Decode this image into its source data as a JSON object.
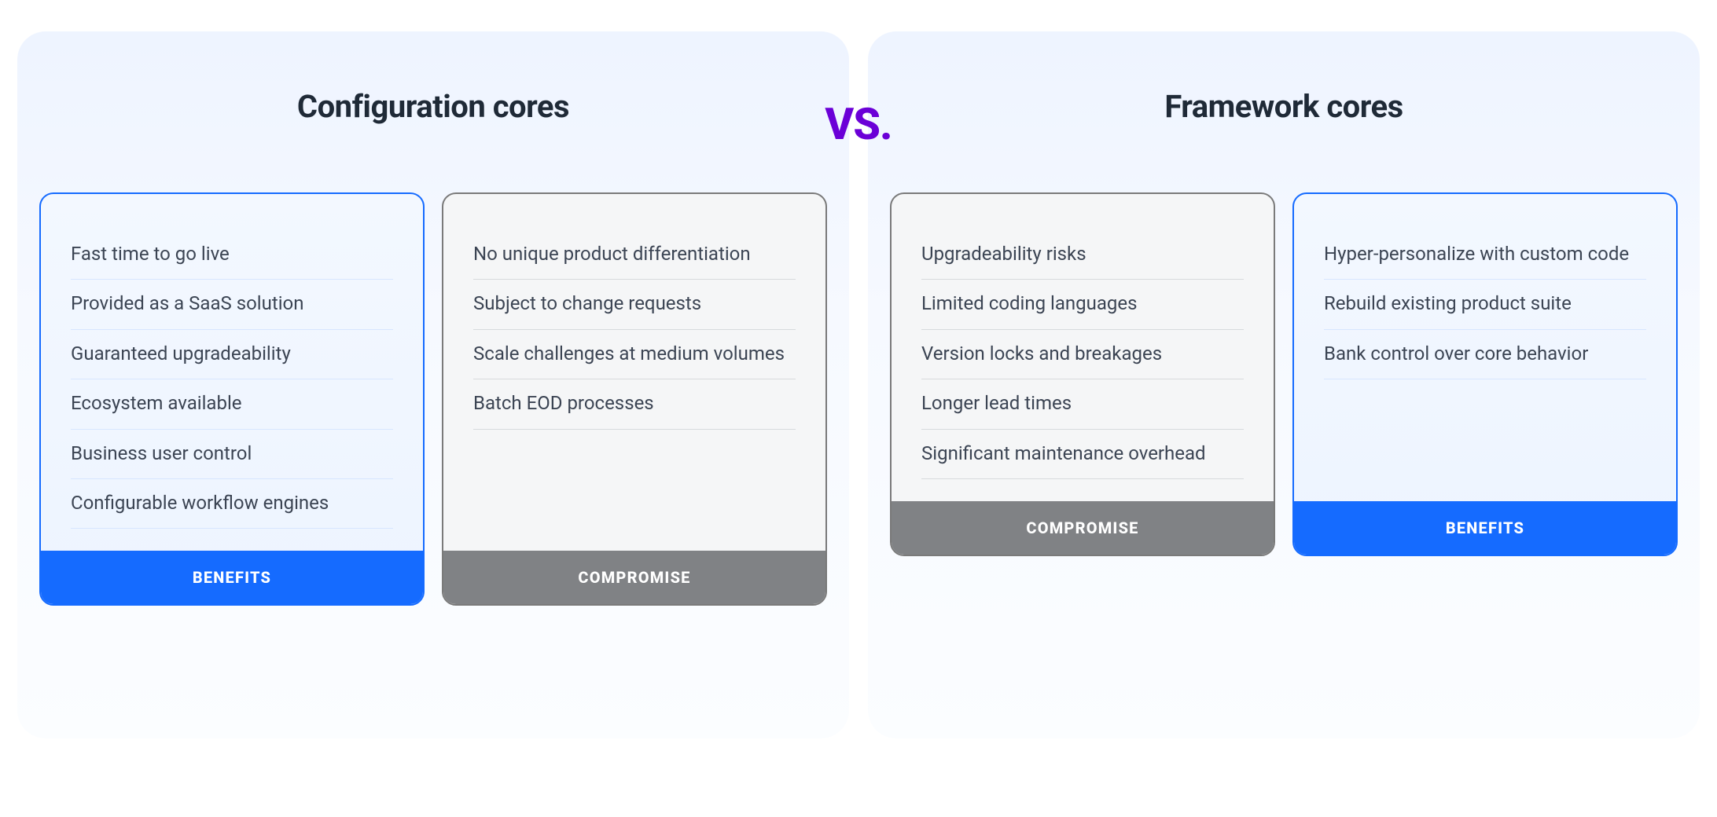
{
  "vs_label": "VS.",
  "footer": {
    "benefits": "BENEFITS",
    "compromise": "COMPROMISE"
  },
  "left": {
    "title": "Configuration cores",
    "benefits": [
      "Fast time to go live",
      "Provided as a SaaS solution",
      "Guaranteed upgradeability",
      "Ecosystem available",
      "Business user control",
      "Configurable workflow engines"
    ],
    "compromise": [
      "No unique product differentiation",
      "Subject to change requests",
      "Scale challenges at medium volumes",
      "Batch EOD processes"
    ]
  },
  "right": {
    "title": "Framework cores",
    "compromise": [
      "Upgradeability risks",
      "Limited coding languages",
      "Version locks and breakages",
      "Longer lead times",
      "Significant maintenance overhead"
    ],
    "benefits": [
      "Hyper-personalize with custom code",
      "Rebuild existing product suite",
      "Bank control over core behavior"
    ]
  }
}
